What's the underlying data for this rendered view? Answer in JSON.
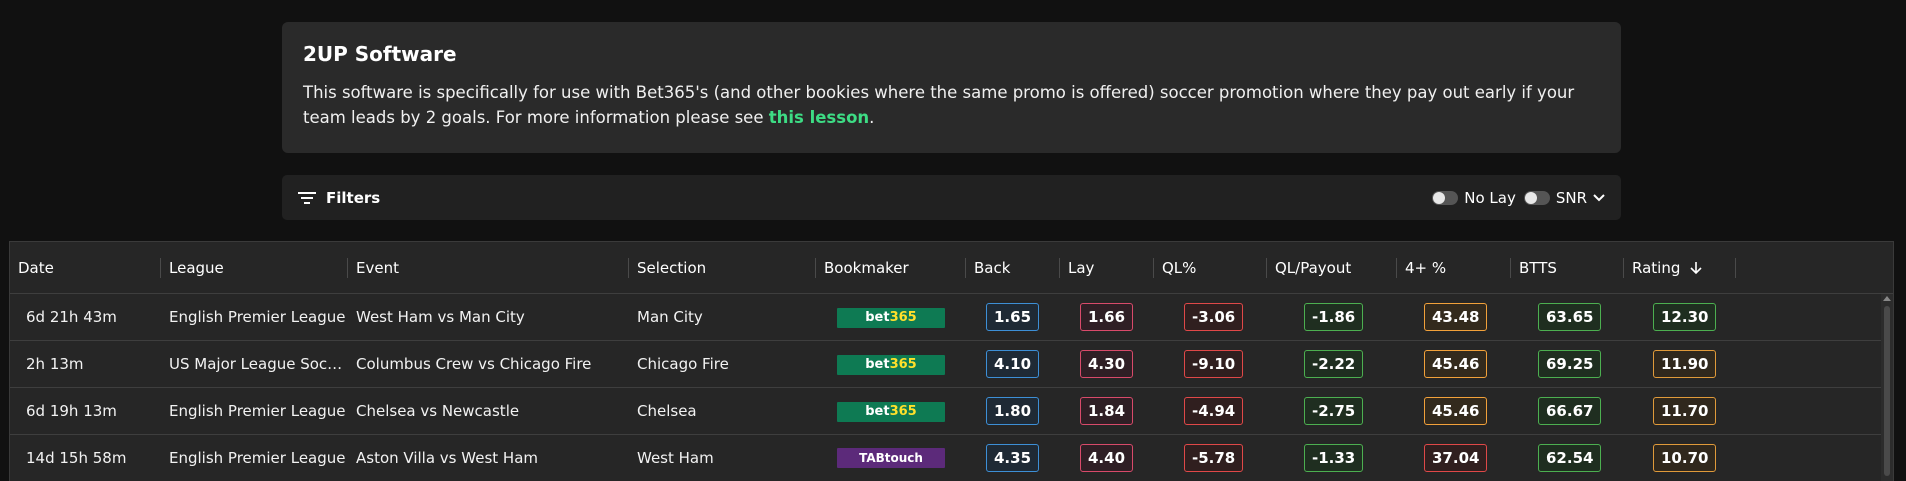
{
  "info": {
    "title": "2UP Software",
    "text_before": "This software is specifically for use with Bet365's (and other bookies where the same promo is offered) soccer promotion where they pay out early if your team leads by 2 goals. For more information please see ",
    "link_text": "this lesson",
    "text_after": "."
  },
  "filters": {
    "label": "Filters",
    "no_lay_label": "No Lay",
    "snr_label": "SNR"
  },
  "table": {
    "headers": [
      "Date",
      "League",
      "Event",
      "Selection",
      "Bookmaker",
      "Back",
      "Lay",
      "QL%",
      "QL/Payout",
      "4+ %",
      "BTTS",
      "Rating"
    ],
    "rows": [
      {
        "date": "6d 21h 43m",
        "league": "English Premier League",
        "event": "West Ham vs Man City",
        "selection": "Man City",
        "bookmaker": "bet365",
        "back": "1.65",
        "lay": "1.66",
        "ql": "-3.06",
        "qlpayout": "-1.86",
        "four": "43.48",
        "btts": "63.65",
        "rating": "12.30"
      },
      {
        "date": "2h 13m",
        "league": "US Major League Soccer",
        "event": "Columbus Crew vs Chicago Fire",
        "selection": "Chicago Fire",
        "bookmaker": "bet365",
        "back": "4.10",
        "lay": "4.30",
        "ql": "-9.10",
        "qlpayout": "-2.22",
        "four": "45.46",
        "btts": "69.25",
        "rating": "11.90"
      },
      {
        "date": "6d 19h 13m",
        "league": "English Premier League",
        "event": "Chelsea vs Newcastle",
        "selection": "Chelsea",
        "bookmaker": "bet365",
        "back": "1.80",
        "lay": "1.84",
        "ql": "-4.94",
        "qlpayout": "-2.75",
        "four": "45.46",
        "btts": "66.67",
        "rating": "11.70"
      },
      {
        "date": "14d 15h 58m",
        "league": "English Premier League",
        "event": "Aston Villa vs West Ham",
        "selection": "West Ham",
        "bookmaker": "TABtouch",
        "back": "4.35",
        "lay": "4.40",
        "ql": "-5.78",
        "qlpayout": "-1.33",
        "four": "37.04",
        "btts": "62.54",
        "rating": "10.70"
      }
    ]
  }
}
